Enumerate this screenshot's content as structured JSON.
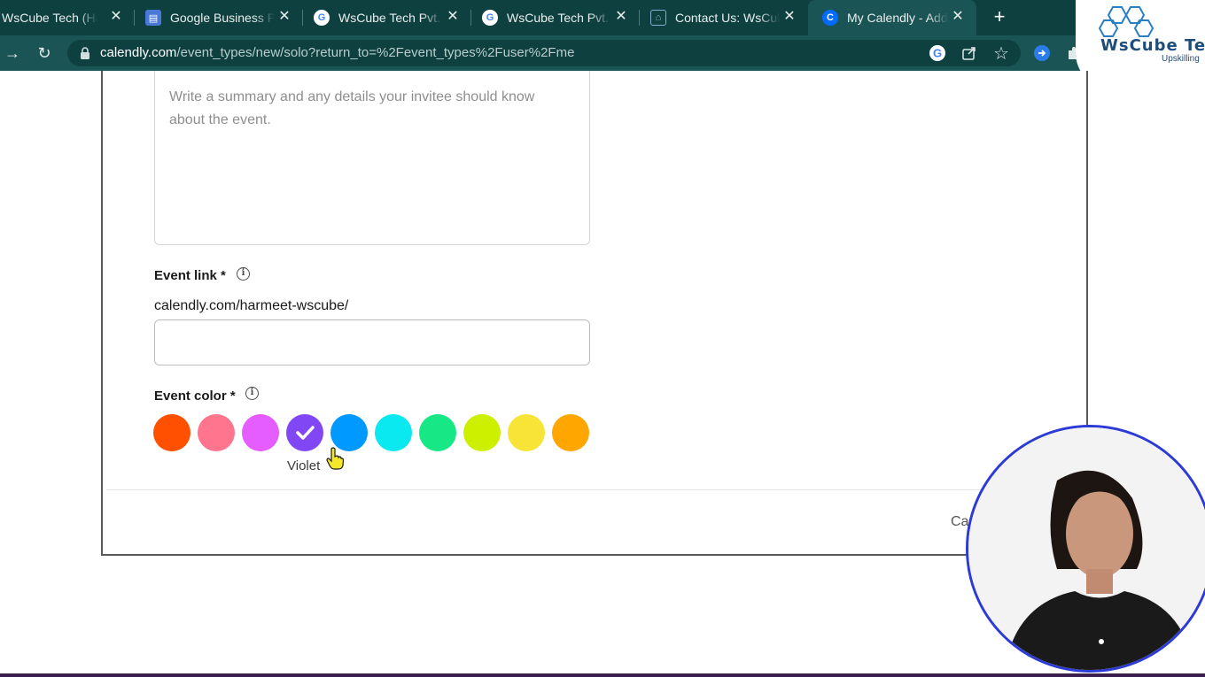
{
  "tabs": [
    {
      "title": "WsCube Tech (Harm",
      "favicon": "wscube-favicon",
      "active": false
    },
    {
      "title": "Google Business Pr",
      "favicon": "google-business-icon",
      "active": false
    },
    {
      "title": "WsCube Tech Pvt. L",
      "favicon": "google-icon",
      "active": false
    },
    {
      "title": "WsCube Tech Pvt. L",
      "favicon": "google-icon",
      "active": false
    },
    {
      "title": "Contact Us: WsCub",
      "favicon": "wscube-house-icon",
      "active": false
    },
    {
      "title": "My Calendly - Add",
      "favicon": "calendly-icon",
      "active": true
    }
  ],
  "address_bar": {
    "host": "calendly.com",
    "path": "/event_types/new/solo?return_to=%2Fevent_types%2Fuser%2Fme"
  },
  "overlay_logo": {
    "name": "WsCube Te",
    "tagline": "Upskilling"
  },
  "form": {
    "description_placeholder": "Write a summary and any details your invitee should know about the event.",
    "event_link_label": "Event link *",
    "event_link_prefix": "calendly.com/harmeet-wscube/",
    "event_link_value": "",
    "event_color_label": "Event color *",
    "colors": [
      {
        "name": "red-orange",
        "hex": "#ff4f00",
        "selected": false
      },
      {
        "name": "pink",
        "hex": "#ff758e",
        "selected": false
      },
      {
        "name": "magenta",
        "hex": "#e55cff",
        "selected": false
      },
      {
        "name": "Violet",
        "hex": "#8247f5",
        "selected": true
      },
      {
        "name": "blue",
        "hex": "#0099ff",
        "selected": false
      },
      {
        "name": "cyan",
        "hex": "#0ae8f0",
        "selected": false
      },
      {
        "name": "green",
        "hex": "#17e885",
        "selected": false
      },
      {
        "name": "lime",
        "hex": "#ccf000",
        "selected": false
      },
      {
        "name": "yellow",
        "hex": "#f8e436",
        "selected": false
      },
      {
        "name": "orange",
        "hex": "#ffa600",
        "selected": false
      }
    ],
    "selected_color_name": "Violet",
    "cancel_label": "Ca"
  }
}
